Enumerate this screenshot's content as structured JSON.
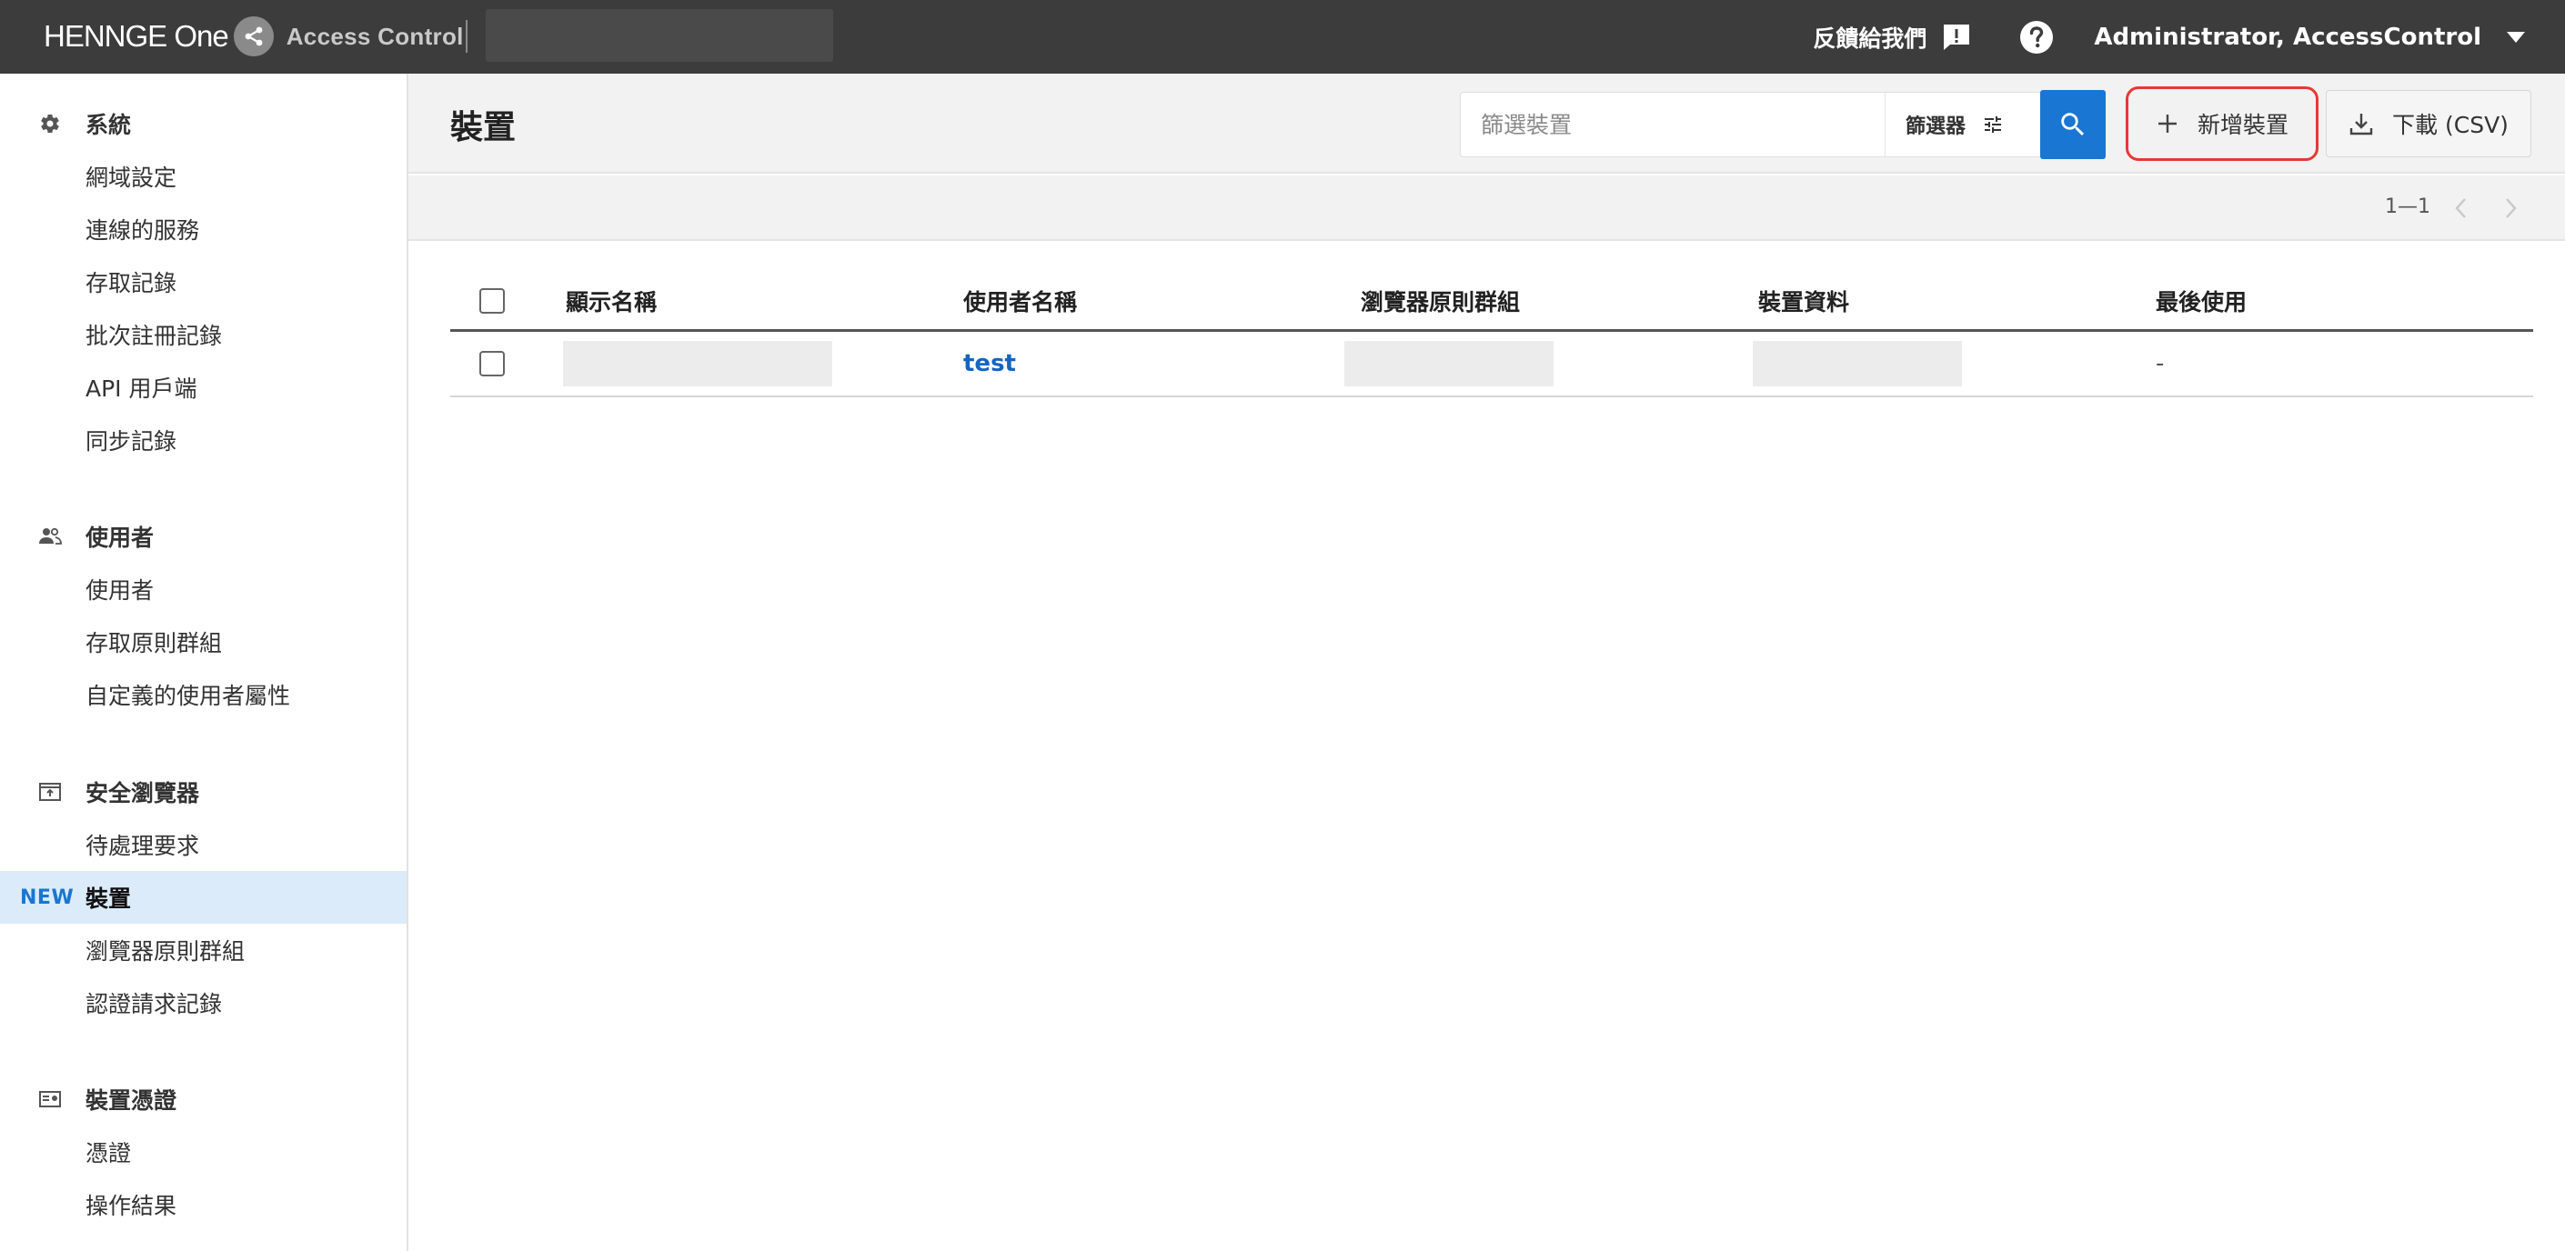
{
  "topbar": {
    "brand": "HENNGE One",
    "product": "Access Control",
    "feedback": "反饋給我們",
    "user": "Administrator, AccessControl"
  },
  "sidebar": {
    "groups": [
      {
        "title": "系統",
        "icon": "gear-icon",
        "items": [
          "網域設定",
          "連線的服務",
          "存取記錄",
          "批次註冊記錄",
          "API 用戶端",
          "同步記錄"
        ]
      },
      {
        "title": "使用者",
        "icon": "users-icon",
        "items": [
          "使用者",
          "存取原則群組",
          "自定義的使用者屬性"
        ]
      },
      {
        "title": "安全瀏覽器",
        "icon": "browser-icon",
        "items": [
          "待處理要求",
          "裝置",
          "瀏覽器原則群組",
          "認證請求記錄"
        ]
      },
      {
        "title": "裝置憑證",
        "icon": "certificate-icon",
        "items": [
          "憑證",
          "操作結果"
        ]
      }
    ],
    "new_badge": "NEW"
  },
  "page": {
    "title": "裝置",
    "search_placeholder": "篩選裝置",
    "filter_label": "篩選器",
    "add_label": "新增裝置",
    "csv_label": "下載 (CSV)",
    "pager": "1—1"
  },
  "table": {
    "columns": [
      "顯示名稱",
      "使用者名稱",
      "瀏覽器原則群組",
      "裝置資料",
      "最後使用"
    ],
    "rows": [
      {
        "display_name": "",
        "username": "test",
        "browser_policy_group": "",
        "device_data": "",
        "last_used": "-"
      }
    ]
  },
  "colors": {
    "topbar": "#3c3c3c",
    "accent": "#1976d2",
    "active_nav": "#dcebfa",
    "highlight": "#e53935"
  }
}
